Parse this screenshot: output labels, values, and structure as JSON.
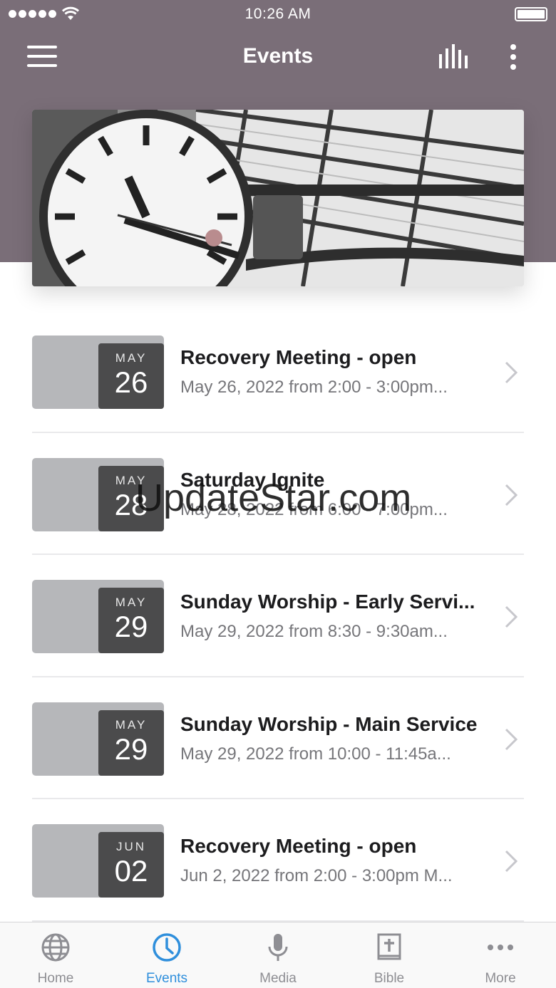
{
  "status_bar": {
    "time": "10:26 AM"
  },
  "nav": {
    "title": "Events"
  },
  "events": [
    {
      "month": "MAY",
      "day": "26",
      "title": "Recovery Meeting - open",
      "subtitle": "May 26, 2022 from 2:00 - 3:00pm..."
    },
    {
      "month": "MAY",
      "day": "28",
      "title": "Saturday Ignite",
      "subtitle": "May 28, 2022 from 6:00 - 7:00pm..."
    },
    {
      "month": "MAY",
      "day": "29",
      "title": "Sunday Worship - Early Servi...",
      "subtitle": "May 29, 2022 from 8:30 - 9:30am..."
    },
    {
      "month": "MAY",
      "day": "29",
      "title": "Sunday Worship - Main Service",
      "subtitle": "May 29, 2022 from 10:00 - 11:45a..."
    },
    {
      "month": "JUN",
      "day": "02",
      "title": "Recovery Meeting - open",
      "subtitle": "Jun 2, 2022 from 2:00 - 3:00pm M..."
    }
  ],
  "watermark": "UpdateStar.com",
  "tabs": [
    {
      "label": "Home",
      "icon": "globe-icon"
    },
    {
      "label": "Events",
      "icon": "clock-icon",
      "active": true
    },
    {
      "label": "Media",
      "icon": "microphone-icon"
    },
    {
      "label": "Bible",
      "icon": "bible-icon"
    },
    {
      "label": "More",
      "icon": "more-dots-icon"
    }
  ],
  "colors": {
    "header": "#7a6e78",
    "accent": "#2f8fdc",
    "date_box": "#4b4b4c",
    "thumb": "#b6b7ba"
  }
}
